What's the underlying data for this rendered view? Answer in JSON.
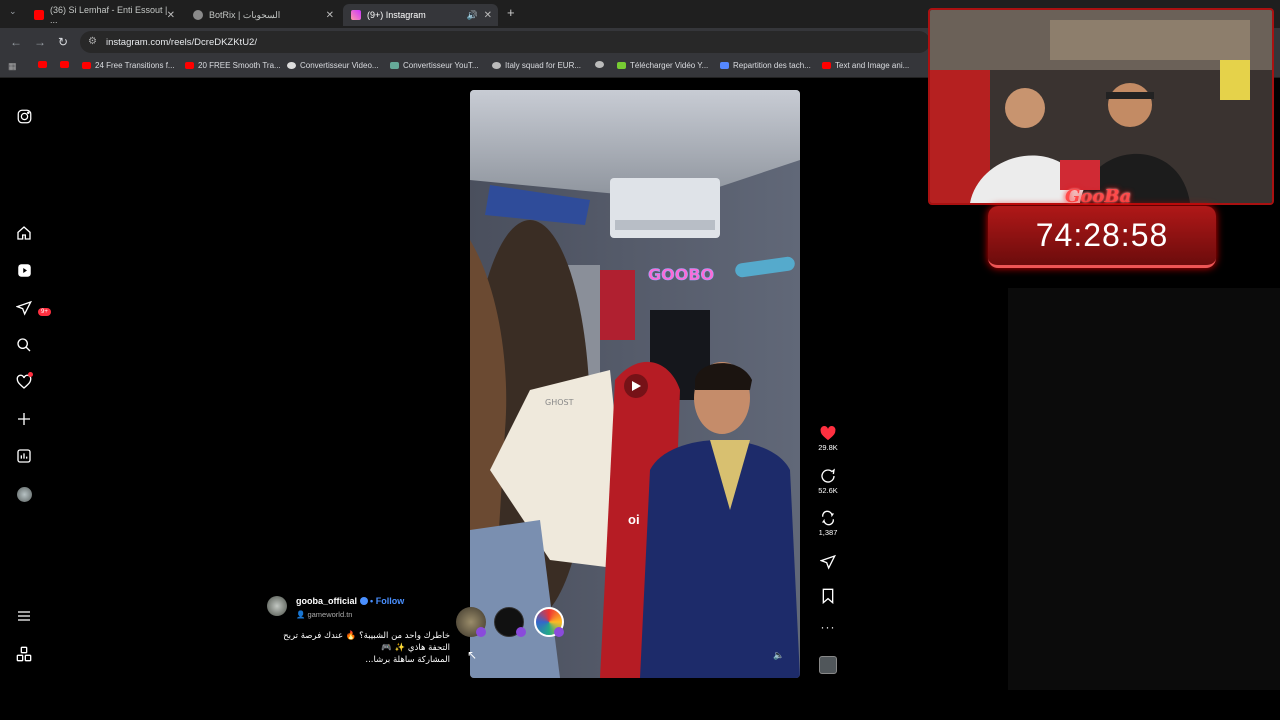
{
  "browser": {
    "tabs": [
      {
        "title": "(36) Si Lemhaf - Enti Essout | ...",
        "favicon": "youtube-icon",
        "color": "#ff0000"
      },
      {
        "title": "BotRix | السحوبات",
        "favicon": "botrix-icon",
        "color": "#888888"
      },
      {
        "title": "(9+) Instagram",
        "favicon": "instagram-icon",
        "color": "#e1306c"
      }
    ],
    "new_tab": "+",
    "url": "instagram.com/reels/DcreDKZKtU2/",
    "bookmarks": [
      "",
      "",
      "24 Free Transitions f...",
      "20 FREE Smooth Tra...",
      "Convertisseur Video...",
      "Convertisseur YouT...",
      "Italy squad for EUR...",
      "",
      "Télécharger Vidéo Y...",
      "Repartition des tach...",
      "Text and Image ani..."
    ]
  },
  "sidebar": {
    "notification_badge": "9+"
  },
  "reel": {
    "username": "gooba_official",
    "follow_label": "Follow",
    "location": "gameworld.tn",
    "caption_line1": "خاطرك واحد من الشبيبة؟ 🔥 عندك فرصة تربح",
    "caption_line2": "التحفة هاذي ✨ 🎮",
    "caption_line3": "المشاركة ساهلة برشا...",
    "overlay_text": "oi",
    "likes": "29.8K",
    "comments": "52.6K",
    "reposts": "1,387"
  },
  "stream_overlay": {
    "brand": "GooBa",
    "timer": "74:28:58"
  },
  "colors": {
    "accent_red": "#ff3040",
    "follow_blue": "#4a90ff"
  }
}
